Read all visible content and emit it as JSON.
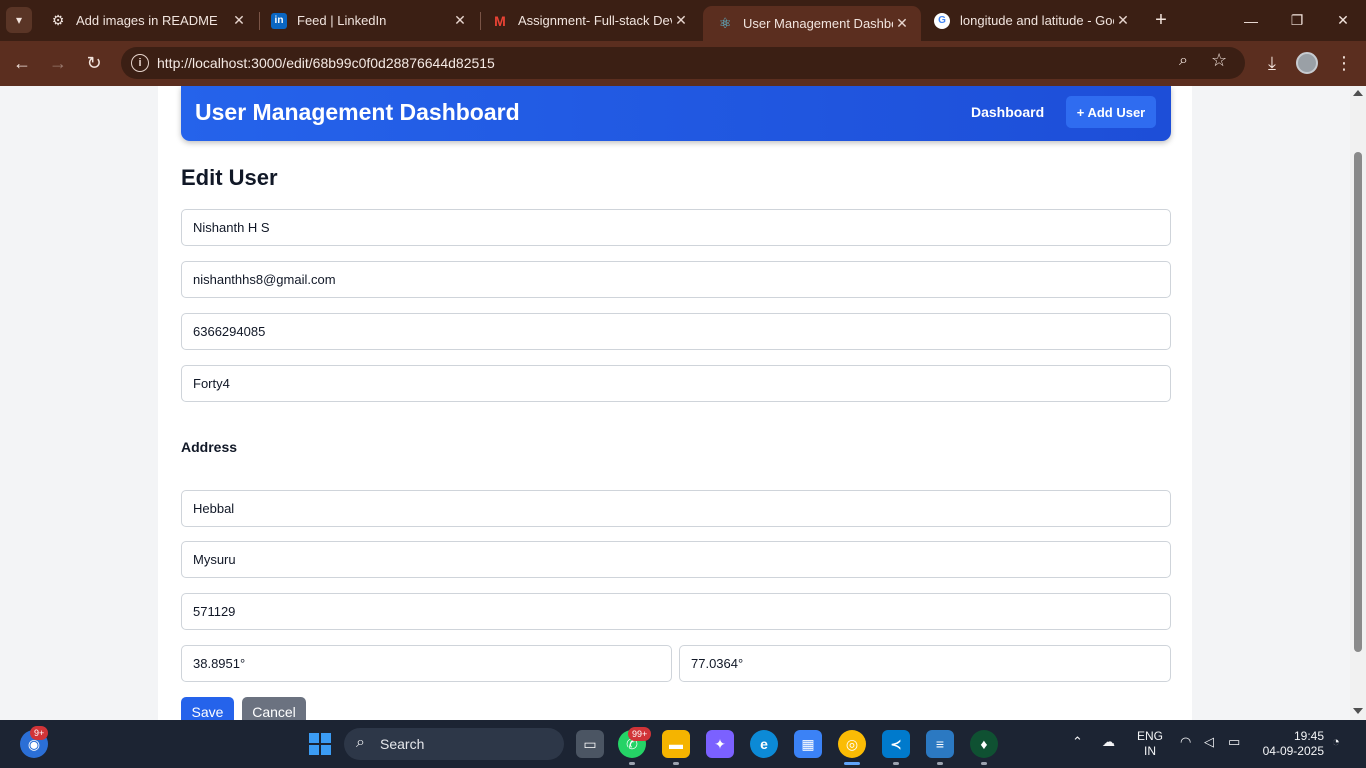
{
  "browser": {
    "tabs": [
      {
        "title": "Add images in README",
        "icon": "chatgpt-icon"
      },
      {
        "title": "Feed | LinkedIn",
        "icon": "linkedin-icon"
      },
      {
        "title": "Assignment- Full-stack Deve",
        "icon": "gmail-icon"
      },
      {
        "title": "User Management Dashboa",
        "icon": "react-icon",
        "active": true
      },
      {
        "title": "longitude and latitude - Goo",
        "icon": "google-icon"
      }
    ],
    "url": "http://localhost:3000/edit/68b99c0f0d28876644d82515"
  },
  "header": {
    "title": "User Management Dashboard",
    "nav_dashboard": "Dashboard",
    "nav_add_user": "+ Add User"
  },
  "form": {
    "title": "Edit User",
    "name": "Nishanth H S",
    "email": "nishanthhs8@gmail.com",
    "phone": "6366294085",
    "company": "Forty4",
    "address_label": "Address",
    "street": "Hebbal",
    "city": "Mysuru",
    "zipcode": "571129",
    "latitude": "38.8951°",
    "longitude": "77.0364°",
    "save_label": "Save",
    "cancel_label": "Cancel"
  },
  "taskbar": {
    "search_label": "Search",
    "chat_badge": "9+",
    "whatsapp_badge": "99+",
    "language_line1": "ENG",
    "language_line2": "IN",
    "time": "19:45",
    "date": "04-09-2025"
  },
  "colors": {
    "header_blue": "#2563eb",
    "save_button": "#2563eb",
    "cancel_button": "#6b7280",
    "browser_frame": "#5b2e1f"
  }
}
